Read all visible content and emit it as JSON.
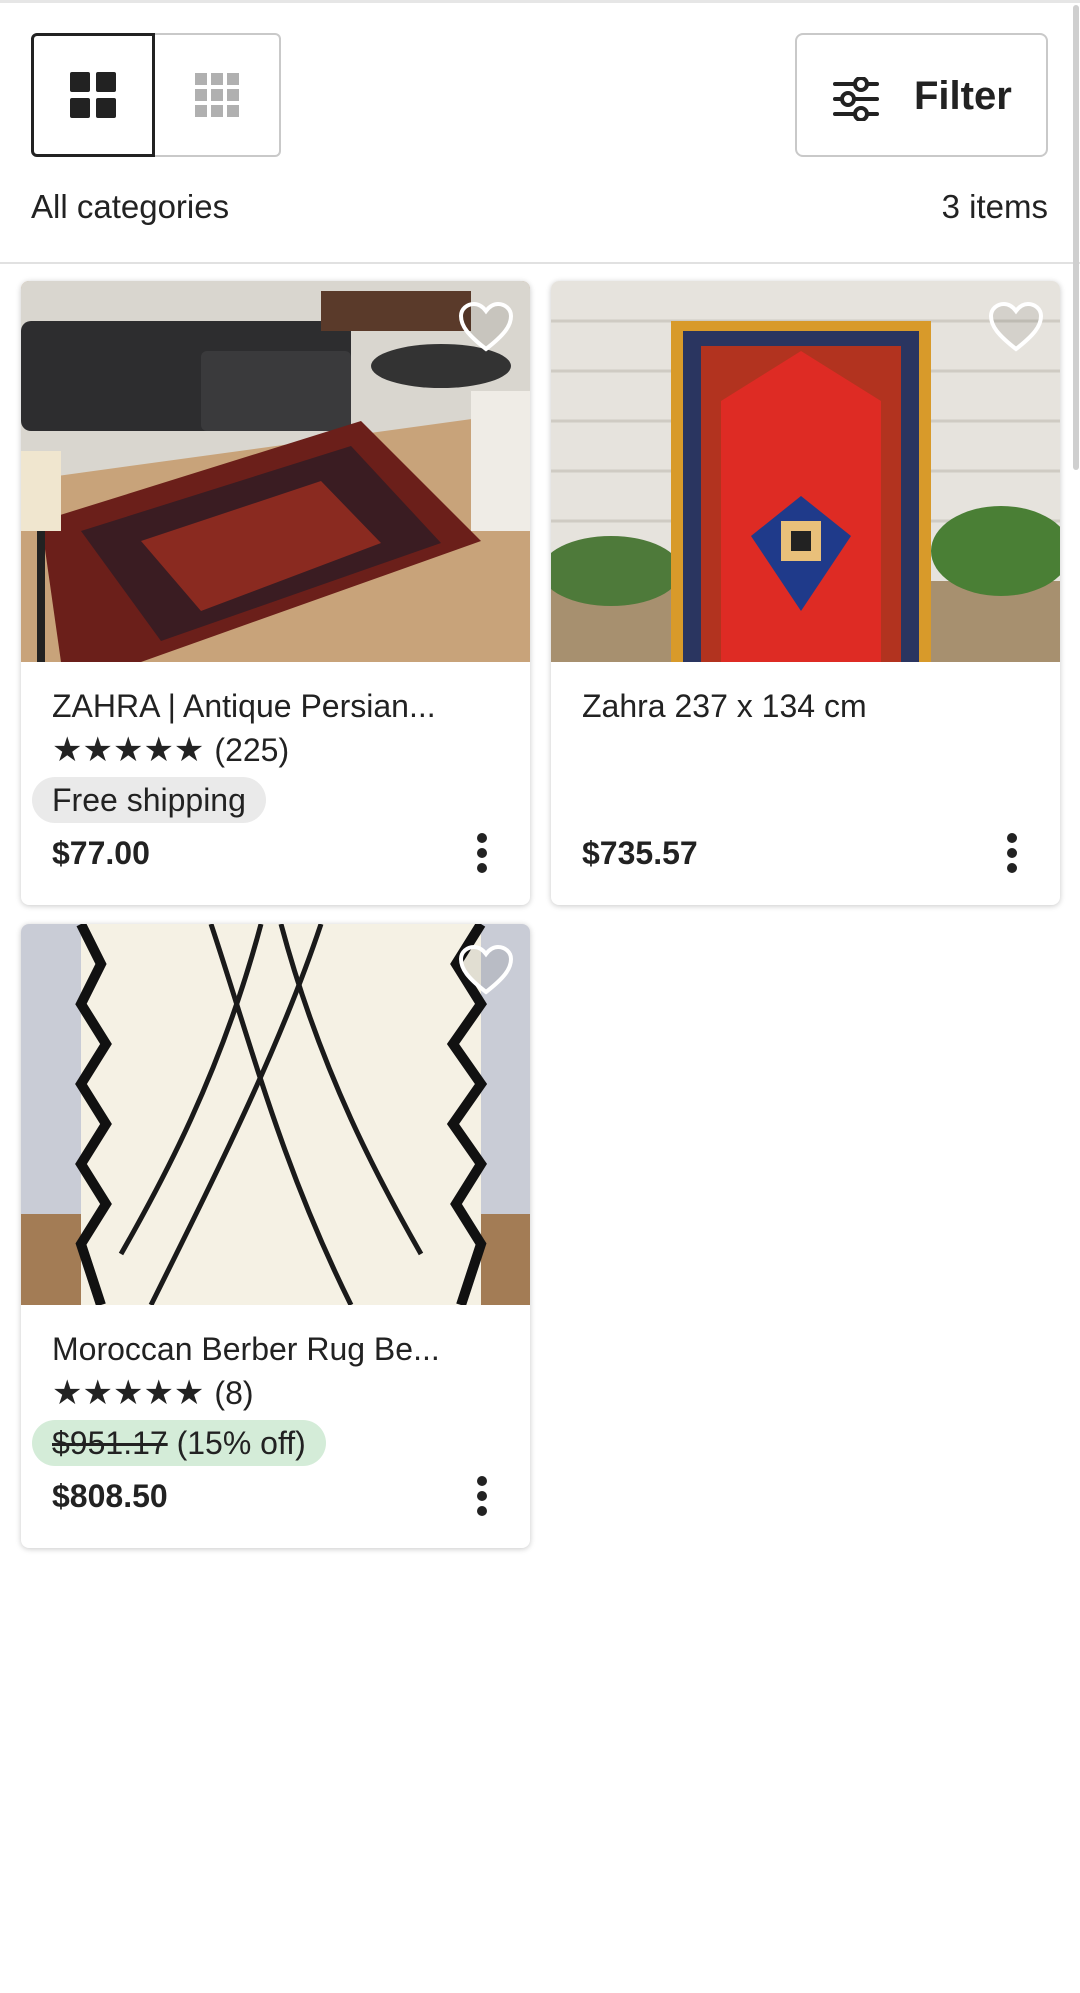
{
  "toolbar": {
    "grid_view_icon": "grid-2x2-icon",
    "dense_view_icon": "grid-3x3-icon",
    "filter_label": "Filter",
    "filter_icon": "sliders-icon",
    "category_label": "All categories",
    "item_count": "3 items"
  },
  "listings": [
    {
      "title": "ZAHRA | Antique Persian...",
      "stars": "★★★★★",
      "reviews": "(225)",
      "badge": "Free shipping",
      "price": "$77.00"
    },
    {
      "title": "Zahra 237 x 134  cm",
      "price": "$735.57"
    },
    {
      "title": "Moroccan Berber Rug Be...",
      "stars": "★★★★★",
      "reviews": "(8)",
      "original_price": "$951.17",
      "discount": "(15% off)",
      "price": "$808.50"
    }
  ],
  "colors": {
    "sale_badge": "#d4ecd8",
    "shipping_badge": "#eaeaea",
    "text": "#222222"
  }
}
